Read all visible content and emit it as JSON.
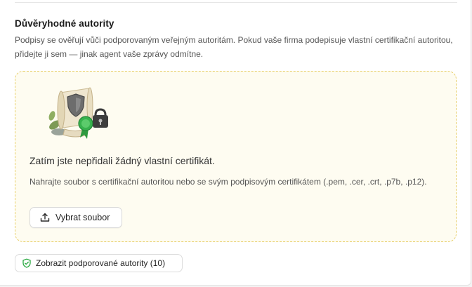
{
  "section": {
    "title": "Důvěryhodné autority",
    "description": "Podpisy se ověřují vůči podporovaným veřejným autoritám. Pokud vaše firma podepisuje vlastní certifikační autoritou, přidejte ji sem — jinak agent vaše zprávy odmítne."
  },
  "empty_state": {
    "title": "Zatím jste nepřidali žádný vlastní certifikát.",
    "description": "Nahrajte soubor s certifikační autoritou nebo se svým podpisovým certifikátem (.pem, .cer, .crt, .p7b, .p12).",
    "upload_label": "Vybrat soubor"
  },
  "supported": {
    "label": "Zobrazit podporované autority (10)"
  },
  "colors": {
    "dropzone_border": "#e8cf6a",
    "dropzone_bg": "#fefcf1",
    "accent_green": "#27a83f"
  },
  "icons": {
    "illustration": "certificate-scroll-illustration",
    "upload": "upload-icon",
    "shield": "shield-check-icon"
  }
}
